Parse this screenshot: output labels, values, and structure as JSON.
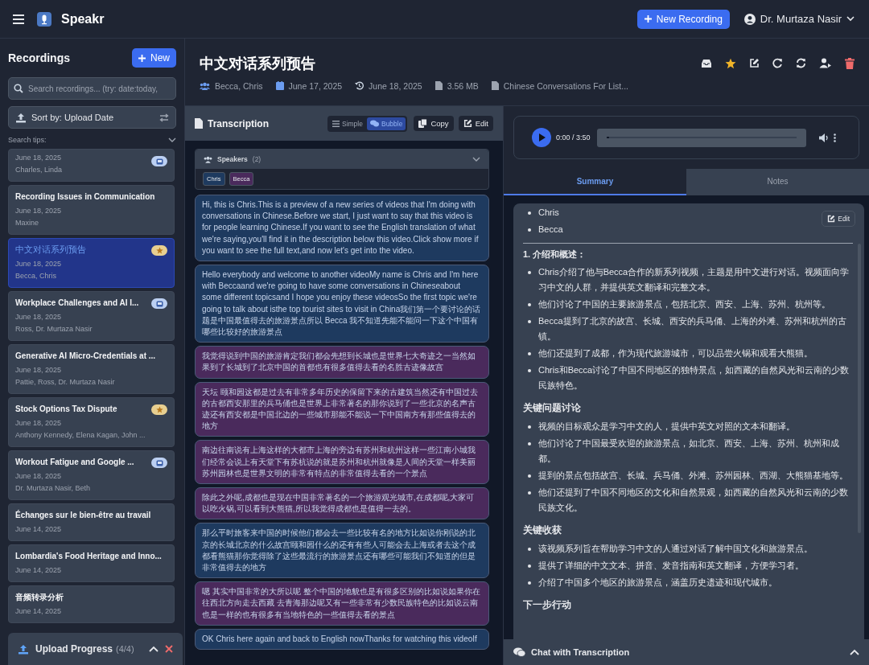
{
  "app": {
    "name": "Speakr",
    "new_recording": "New Recording",
    "user": "Dr. Murtaza Nasir"
  },
  "sidebar": {
    "title": "Recordings",
    "new_button": "New",
    "search": {
      "placeholder": "Search recordings... (try: date:today,"
    },
    "sort": "Sort by: Upload Date",
    "search_tips": "Search tips:",
    "items": [
      {
        "date": "June 18, 2025",
        "speakers": "Charles, Linda",
        "starred": false,
        "inbox": true,
        "selected": false
      },
      {
        "title": "Recording Issues in Communication",
        "date": "June 18, 2025",
        "speakers": "Maxine",
        "starred": false,
        "inbox": false,
        "selected": false
      },
      {
        "title": "中文对话系列预告",
        "date": "June 18, 2025",
        "speakers": "Becca, Chris",
        "starred": true,
        "inbox": false,
        "selected": true
      },
      {
        "title": "Workplace Challenges and AI I...",
        "date": "June 18, 2025",
        "speakers": "Ross, Dr. Murtaza Nasir",
        "starred": false,
        "inbox": true,
        "selected": false
      },
      {
        "title": "Generative AI Micro-Credentials at ...",
        "date": "June 18, 2025",
        "speakers": "Pattie, Ross, Dr. Murtaza Nasir",
        "starred": false,
        "inbox": false,
        "selected": false
      },
      {
        "title": "Stock Options Tax Dispute",
        "date": "June 18, 2025",
        "speakers": "Anthony Kennedy, Elena Kagan, John ...",
        "starred": true,
        "inbox": false,
        "selected": false
      },
      {
        "title": "Workout Fatigue and Google ...",
        "date": "June 18, 2025",
        "speakers": "Dr. Murtaza Nasir, Beth",
        "starred": false,
        "inbox": true,
        "selected": false
      },
      {
        "title": "Échanges sur le bien-être au travail",
        "date": "June 14, 2025",
        "starred": false,
        "inbox": false,
        "selected": false
      },
      {
        "title": "Lombardia's Food Heritage and Inno...",
        "date": "June 14, 2025",
        "starred": false,
        "inbox": false,
        "selected": false
      },
      {
        "title": "音频转录分析",
        "date": "June 14, 2025",
        "starred": false,
        "inbox": false,
        "selected": false
      }
    ],
    "upload": {
      "label": "Upload Progress",
      "count": "(4/4)"
    }
  },
  "recording": {
    "title": "中文对话系列预告",
    "participants": "Becca, Chris",
    "created": "June 17, 2025",
    "uploaded": "June 18, 2025",
    "size": "3.56 MB",
    "file": "Chinese Conversations For List..."
  },
  "transcription": {
    "title": "Transcription",
    "views": [
      {
        "label": "Simple",
        "selected": false
      },
      {
        "label": "Bubble",
        "selected": true
      }
    ],
    "copy": "Copy",
    "edit": "Edit",
    "speakers_label": "Speakers",
    "speakers_count": "(2)",
    "speakers": [
      {
        "name": "Chris",
        "color": "#1e3a5f"
      },
      {
        "name": "Becca",
        "color": "#4a2a5c"
      }
    ],
    "bubbles": [
      {
        "color": "#1e3a5f",
        "text": "Hi, this is Chris.This is a preview of a new series of videos that I'm doing with conversations in Chinese.Before we start, I just want to say that this video is for people learning Chinese.If you want to see the English translation of what we're saying,you'll find it in the description below this video.Click show more if you want to see the full text,and now let's get into the video."
      },
      {
        "color": "#1e3a5f",
        "text": "Hello everybody and welcome to another videoMy name is Chris and I'm here with Beccaand we're going to have some conversations in Chineseabout some different topicsand I hope you enjoy these videosSo the first topic we're going to talk about isthe top tourist sites to visit in China我们第一个要讨论的话题是中国最值得去的旅游景点所以 Becca 我不知道先能不能问一下这个中国有哪些比较好的旅游景点"
      },
      {
        "color": "#4a2a5c",
        "text": "我觉得说到中国的旅游肯定我们都会先想到长城也是世界七大奇迹之一当然如果到了长城到了北京中国的首都也有很多值得去看的名胜古迹像故宫"
      },
      {
        "color": "#4a2a5c",
        "text": "天坛 颐和园这都是过去有非常多年历史的保留下来的古建筑当然还有中国过去的古都西安那里的兵马俑也是世界上非常著名的那你说到了一些北京的名声古迹还有西安都是中国北边的一些城市那能不能说一下中国南方有那些值得去的地方"
      },
      {
        "color": "#4a2a5c",
        "text": "南边往南说有上海这样的大都市上海的旁边有苏州和杭州这样一些江南小城我们经常会说上有天堂下有苏杭说的就是苏州和杭州就像是人间的天堂一样美丽苏州园林也是世界文明的非常有特点的非常值得去看的一个景点"
      },
      {
        "color": "#4a2a5c",
        "text": "除此之外呢,成都也是现在中国非常著名的一个旅游观光城市,在成都呢,大家可以吃火锅,可以看到大熊猫,所以我觉得成都也是值得一去的。"
      },
      {
        "color": "#1e3a5f",
        "text": "那么平时旅客来中国的时候他们都会去一些比较有名的地方比如说你刚说的北京的长城北京的什么故宫颐和园什么的还有有些人可能会去上海或者去这个成都看熊猫那你觉得除了这些最流行的旅游景点还有哪些可能我们不知道的但是非常值得去的地方"
      },
      {
        "color": "#4a2a5c",
        "text": "嗯 其实中国非常的大所以呢 整个中国的地貌也是有很多区别的比如说如果你在往西北方向走去西藏 去青海那边呢又有一些非常有少数民族特色的比如说云南也是一样的也有很多有当地特色的一些值得去看的景点"
      },
      {
        "color": "#1e3a5f",
        "text": "OK Chris here again and back to English nowThanks for watching this videoIf"
      }
    ]
  },
  "player": {
    "time": "0:00 / 3:50",
    "level": 0.01
  },
  "tabs": [
    {
      "label": "Summary",
      "selected": true
    },
    {
      "label": "Notes",
      "selected": false
    }
  ],
  "summary": {
    "edit": "Edit",
    "blocks": [
      {
        "kind": "bullets",
        "items": [
          "Chris",
          "Becca"
        ]
      },
      {
        "kind": "rule"
      },
      {
        "kind": "numbered",
        "text": "1. 介绍和概述："
      },
      {
        "kind": "bullets",
        "items": [
          "Chris介绍了他与Becca合作的新系列视频，主题是用中文进行对话。视频面向学习中文的人群，并提供英文翻译和完整文本。",
          "他们讨论了中国的主要旅游景点，包括北京、西安、上海、苏州、杭州等。",
          "Becca提到了北京的故宫、长城、西安的兵马俑、上海的外滩、苏州和杭州的古镇。",
          "他们还提到了成都，作为现代旅游城市，可以品尝火锅和观看大熊猫。",
          "Chris和Becca讨论了中国不同地区的独特景点，如西藏的自然风光和云南的少数民族特色。"
        ]
      },
      {
        "kind": "heading",
        "text": "关键问题讨论"
      },
      {
        "kind": "bullets",
        "items": [
          "视频的目标观众是学习中文的人，提供中英文对照的文本和翻译。",
          "他们讨论了中国最受欢迎的旅游景点，如北京、西安、上海、苏州、杭州和成都。",
          "提到的景点包括故宫、长城、兵马俑、外滩、苏州园林、西湖、大熊猫基地等。",
          "他们还提到了中国不同地区的文化和自然景观，如西藏的自然风光和云南的少数民族文化。"
        ]
      },
      {
        "kind": "heading",
        "text": "关键收获"
      },
      {
        "kind": "bullets",
        "items": [
          "该视频系列旨在帮助学习中文的人通过对话了解中国文化和旅游景点。",
          "提供了详细的中文文本、拼音、发音指南和英文翻译，方便学习者。",
          "介绍了中国多个地区的旅游景点，涵盖历史遗迹和现代城市。"
        ]
      },
      {
        "kind": "heading",
        "text": "下一步行动"
      }
    ]
  },
  "chat": {
    "label": "Chat with Transcription"
  }
}
